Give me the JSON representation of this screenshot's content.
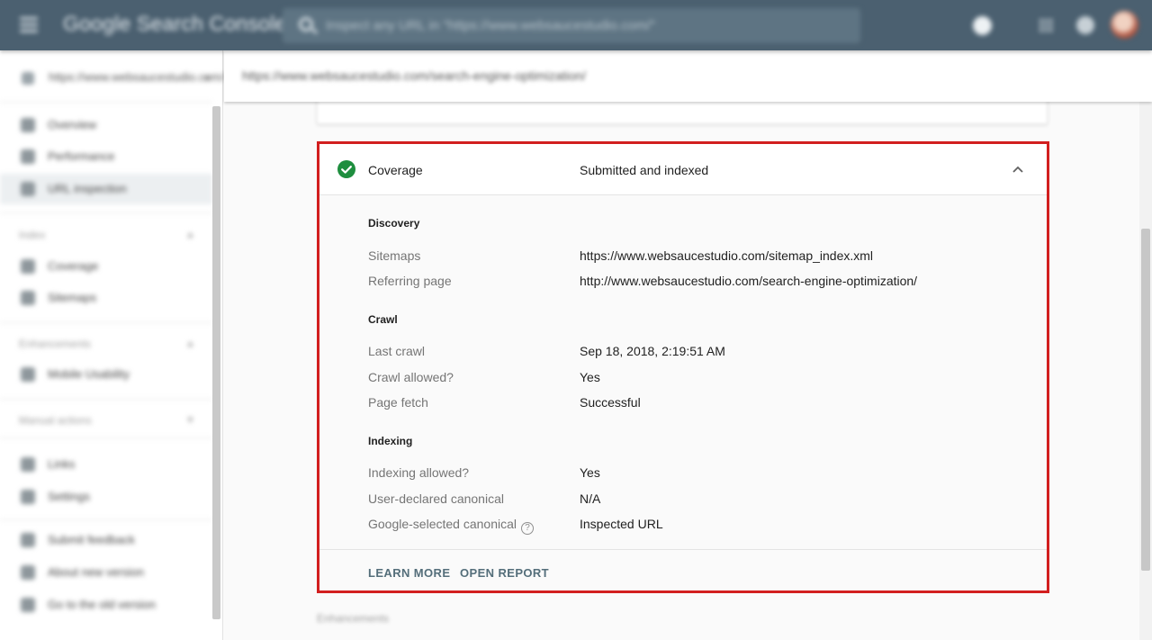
{
  "topbar": {
    "app_name": "Google Search Console",
    "search_placeholder": "Inspect any URL in \"https://www.websaucestudio.com/\""
  },
  "sidebar": {
    "property": "https://www.websaucestudio.com/",
    "nav": [
      {
        "label": "Overview",
        "icon": "home-icon"
      },
      {
        "label": "Performance",
        "icon": "trend-icon"
      },
      {
        "label": "URL inspection",
        "icon": "search-icon",
        "active": true
      }
    ],
    "sections": [
      {
        "title": "Index",
        "items": [
          {
            "label": "Coverage",
            "icon": "coverage-icon"
          },
          {
            "label": "Sitemaps",
            "icon": "sitemaps-icon"
          }
        ]
      },
      {
        "title": "Enhancements",
        "items": [
          {
            "label": "Mobile Usability",
            "icon": "phone-icon"
          }
        ]
      },
      {
        "title": "Manual actions",
        "items": []
      }
    ],
    "extra": [
      {
        "label": "Links",
        "icon": "people-icon"
      },
      {
        "label": "Settings",
        "icon": "gear-icon"
      }
    ],
    "bottom": [
      {
        "label": "Submit feedback",
        "icon": "feedback-icon"
      },
      {
        "label": "About new version",
        "icon": "info-icon"
      },
      {
        "label": "Go to the old version",
        "icon": "exit-icon"
      }
    ]
  },
  "url_header": "https://www.websaucestudio.com/search-engine-optimization/",
  "coverage": {
    "title": "Coverage",
    "status": "Submitted and indexed",
    "status_color": "#1e8e3e",
    "sections": [
      {
        "title": "Discovery",
        "rows": [
          {
            "label": "Sitemaps",
            "value": "https://www.websaucestudio.com/sitemap_index.xml"
          },
          {
            "label": "Referring page",
            "value": "http://www.websaucestudio.com/search-engine-optimization/"
          }
        ]
      },
      {
        "title": "Crawl",
        "rows": [
          {
            "label": "Last crawl",
            "value": "Sep 18, 2018, 2:19:51 AM"
          },
          {
            "label": "Crawl allowed?",
            "value": "Yes"
          },
          {
            "label": "Page fetch",
            "value": "Successful"
          }
        ]
      },
      {
        "title": "Indexing",
        "rows": [
          {
            "label": "Indexing allowed?",
            "value": "Yes"
          },
          {
            "label": "User-declared canonical",
            "value": "N/A"
          },
          {
            "label": "Google-selected canonical",
            "value": "Inspected URL",
            "help_icon": "?"
          }
        ]
      }
    ],
    "actions": {
      "learn_more": "LEARN MORE",
      "open_report": "OPEN REPORT"
    },
    "highlight_color": "#d21f1f"
  },
  "next_section": "Enhancements"
}
